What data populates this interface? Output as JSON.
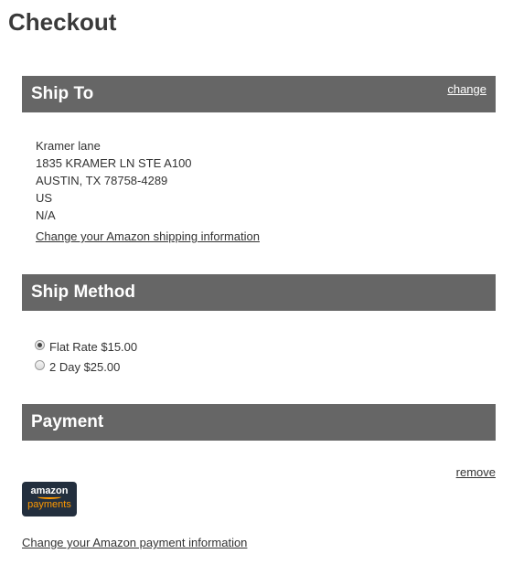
{
  "page": {
    "title": "Checkout"
  },
  "ship_to": {
    "header": "Ship To",
    "change_link": "change",
    "address_lines": [
      "Kramer lane",
      "1835 KRAMER LN STE A100",
      "AUSTIN, TX 78758-4289",
      "US",
      "N/A"
    ],
    "change_amazon_link": "Change your Amazon shipping information"
  },
  "ship_method": {
    "header": "Ship Method",
    "options": [
      {
        "label": "Flat Rate $15.00",
        "selected": true
      },
      {
        "label": "2 Day $25.00",
        "selected": false
      }
    ]
  },
  "payment": {
    "header": "Payment",
    "remove_link": "remove",
    "badge": {
      "brand": "amazon",
      "sub": "payments"
    },
    "change_amazon_link": "Change your Amazon payment information"
  },
  "colors": {
    "header_bg": "#666666",
    "amazon_dark": "#232f3e",
    "amazon_orange": "#ff9900"
  }
}
